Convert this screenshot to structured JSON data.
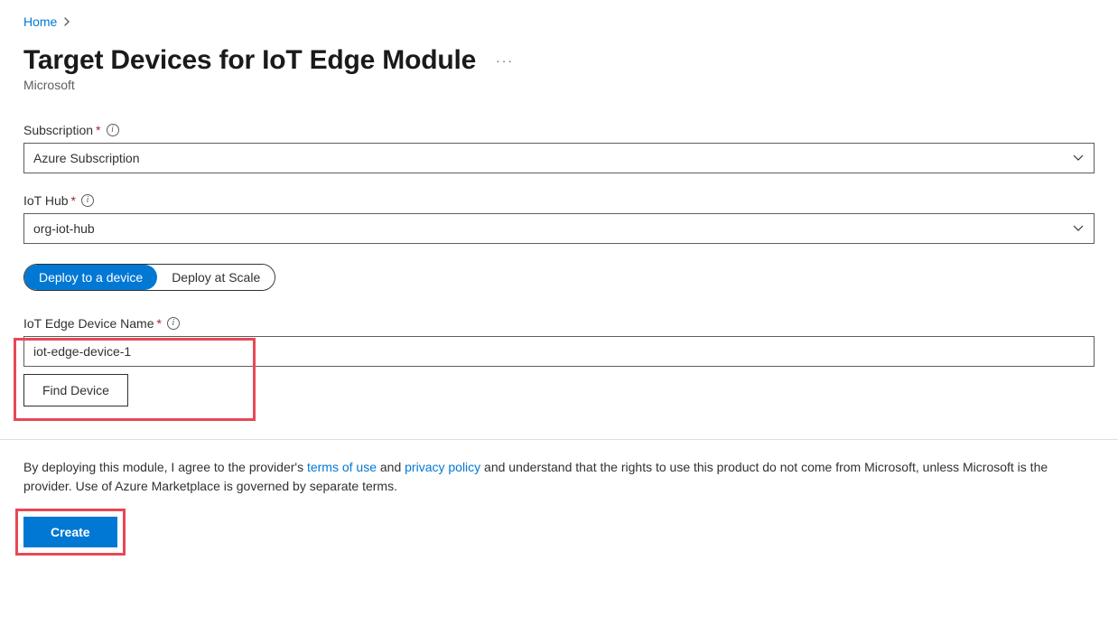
{
  "breadcrumb": {
    "home": "Home"
  },
  "header": {
    "title": "Target Devices for IoT Edge Module",
    "subtitle": "Microsoft"
  },
  "fields": {
    "subscription": {
      "label": "Subscription",
      "value": "Azure Subscription"
    },
    "iotHub": {
      "label": "IoT Hub",
      "value": "org-iot-hub"
    },
    "deviceName": {
      "label": "IoT Edge Device Name",
      "value": "iot-edge-device-1"
    }
  },
  "toggles": {
    "deployToDevice": "Deploy to a device",
    "deployAtScale": "Deploy at Scale"
  },
  "buttons": {
    "findDevice": "Find Device",
    "create": "Create"
  },
  "agreement": {
    "prefix": "By deploying this module, I agree to the provider's ",
    "termsLink": "terms of use",
    "mid1": " and ",
    "privacyLink": "privacy policy",
    "suffix": " and understand that the rights to use this product do not come from Microsoft, unless Microsoft is the provider. Use of Azure Marketplace is governed by separate terms."
  }
}
